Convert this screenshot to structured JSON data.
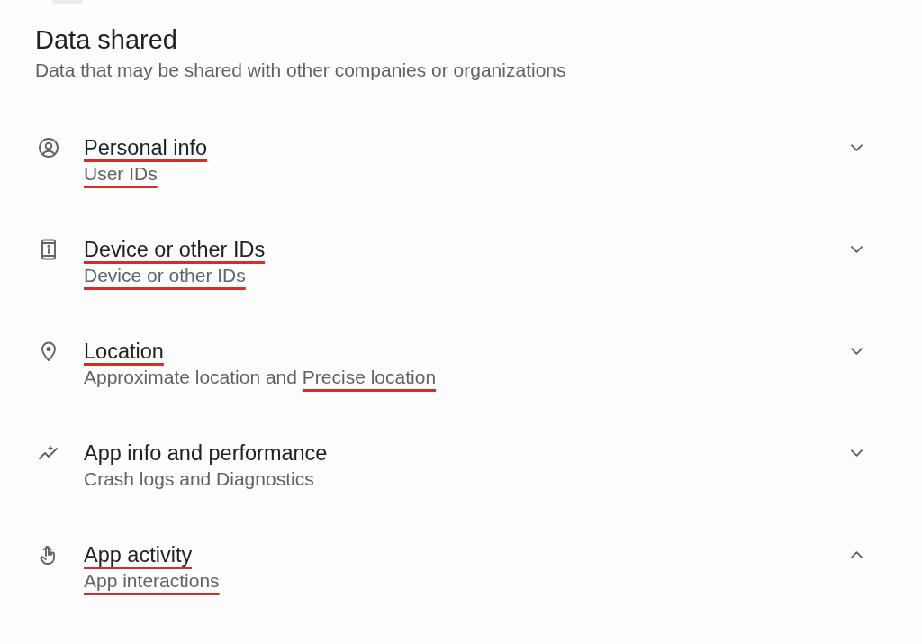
{
  "header": {
    "title": "Data shared",
    "subtitle": "Data that may be shared with other companies or organizations"
  },
  "items": [
    {
      "title": {
        "text": "Personal info",
        "underlined": true
      },
      "subtitle": [
        {
          "text": "User IDs",
          "underlined": true
        }
      ],
      "expanded": false
    },
    {
      "title": {
        "text": "Device or other IDs",
        "underlined": true
      },
      "subtitle": [
        {
          "text": "Device or other IDs",
          "underlined": true
        }
      ],
      "expanded": false
    },
    {
      "title": {
        "text": "Location",
        "underlined": true
      },
      "subtitle": [
        {
          "text": "Approximate location and",
          "underlined": false
        },
        {
          "text": "Precise location",
          "underlined": true
        }
      ],
      "expanded": false
    },
    {
      "title": {
        "text": "App info and performance",
        "underlined": false
      },
      "subtitle": [
        {
          "text": "Crash logs and Diagnostics",
          "underlined": false
        }
      ],
      "expanded": false
    },
    {
      "title": {
        "text": "App activity",
        "underlined": true
      },
      "subtitle": [
        {
          "text": "App interactions",
          "underlined": true
        }
      ],
      "expanded": true
    }
  ]
}
